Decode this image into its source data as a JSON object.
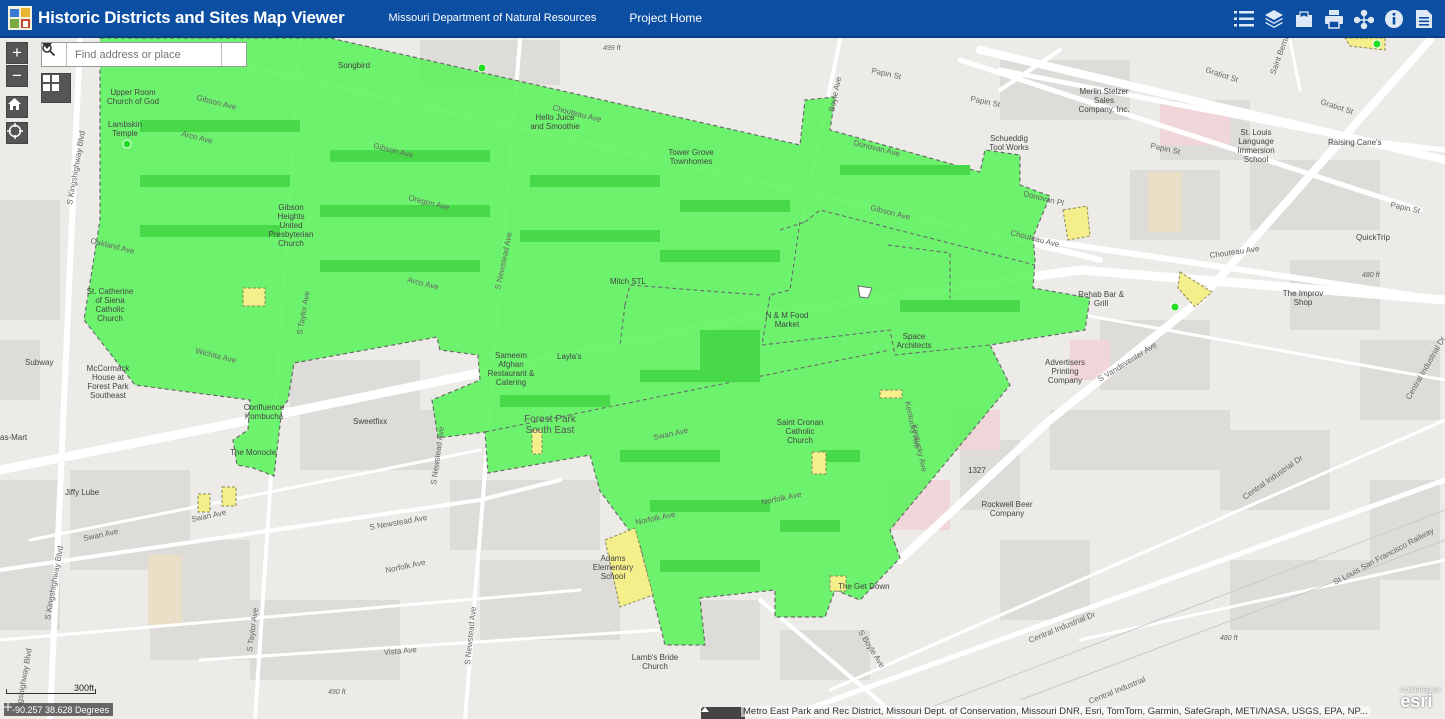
{
  "header": {
    "title": "Historic Districts and Sites Map Viewer",
    "links": [
      "Missouri Department of Natural Resources",
      "Project Home"
    ],
    "tools": [
      "list-icon",
      "layers-icon",
      "legend-icon",
      "print-icon",
      "share-icon",
      "info-icon",
      "document-icon"
    ]
  },
  "search": {
    "placeholder": "Find address or place"
  },
  "controls": {
    "zoom_in": "+",
    "zoom_out": "−"
  },
  "scale": {
    "label": "300ft"
  },
  "coords": {
    "text": "-90.257 38.628 Degrees"
  },
  "attribution": "Metro East Park and Rec District, Missouri Dept. of Conservation, Missouri DNR, Esri, TomTom, Garmin, SafeGraph, METI/NASA, USGS, EPA, NP...",
  "esri": {
    "powered": "POWERED BY",
    "brand": "esri"
  },
  "colors": {
    "header": "#0b4ea2",
    "district_fill": "#5bf25b",
    "site_fill": "#f4ef8a",
    "site_point": "#22dd22"
  },
  "map_labels": {
    "streets": [
      "Papin St",
      "Gratiot St",
      "Saint Bernard",
      "Gibson Ave",
      "Chouteau Ave",
      "Arco Ave",
      "Oregon Ave",
      "Oakland Ave",
      "Wichita Ave",
      "Swan Ave",
      "Norfolk Ave",
      "Vista Ave",
      "Donovan Ave",
      "Donovan Pl",
      "Boyle Ave",
      "S Newstead Ave",
      "S Taylor Ave",
      "S Kingshighway Blvd",
      "Kentucky Ave",
      "S Vandeventer Ave",
      "Central Industrial Dr",
      "St Louis San Francisco Railway",
      "S Boyle Ave",
      "Kingshighway Blvd",
      "Central Industrial"
    ],
    "pois": [
      "Songbird",
      "Upper Room Church of God",
      "Lambskin Temple",
      "Hello Juice and Smoothie",
      "Tower Grove Townhomes",
      "Gibson Heights United Presbyterian Church",
      "Mitch STL",
      "St. Catherine of Siena Catholic Church",
      "McCormack House at Forest Park Southeast",
      "Subway",
      "Sameem Afghan Restaurant & Catering",
      "Layla's",
      "Confluence Kombucha",
      "The Monocle",
      "Sweetfixx",
      "as-Mart",
      "Jiffy Lube",
      "N & M Food Market",
      "Space Architects",
      "Saint Cronan Catholic Church",
      "Adams Elementary School",
      "Lamb's Bride Church",
      "The Get Down",
      "Merlin Stelzer Sales Company, Inc.",
      "Schueddig Tool Works",
      "St. Louis Language Immersion School",
      "Raising Cane's",
      "QuickTrip",
      "Rehab Bar & Grill",
      "The Improv Shop",
      "Advertisers Printing Company",
      "Rockwell Beer Company",
      "1327"
    ],
    "neighborhood": [
      "Forest Park",
      "South East"
    ],
    "elevations": [
      "499 ft",
      "480 ft",
      "490 ft"
    ]
  }
}
